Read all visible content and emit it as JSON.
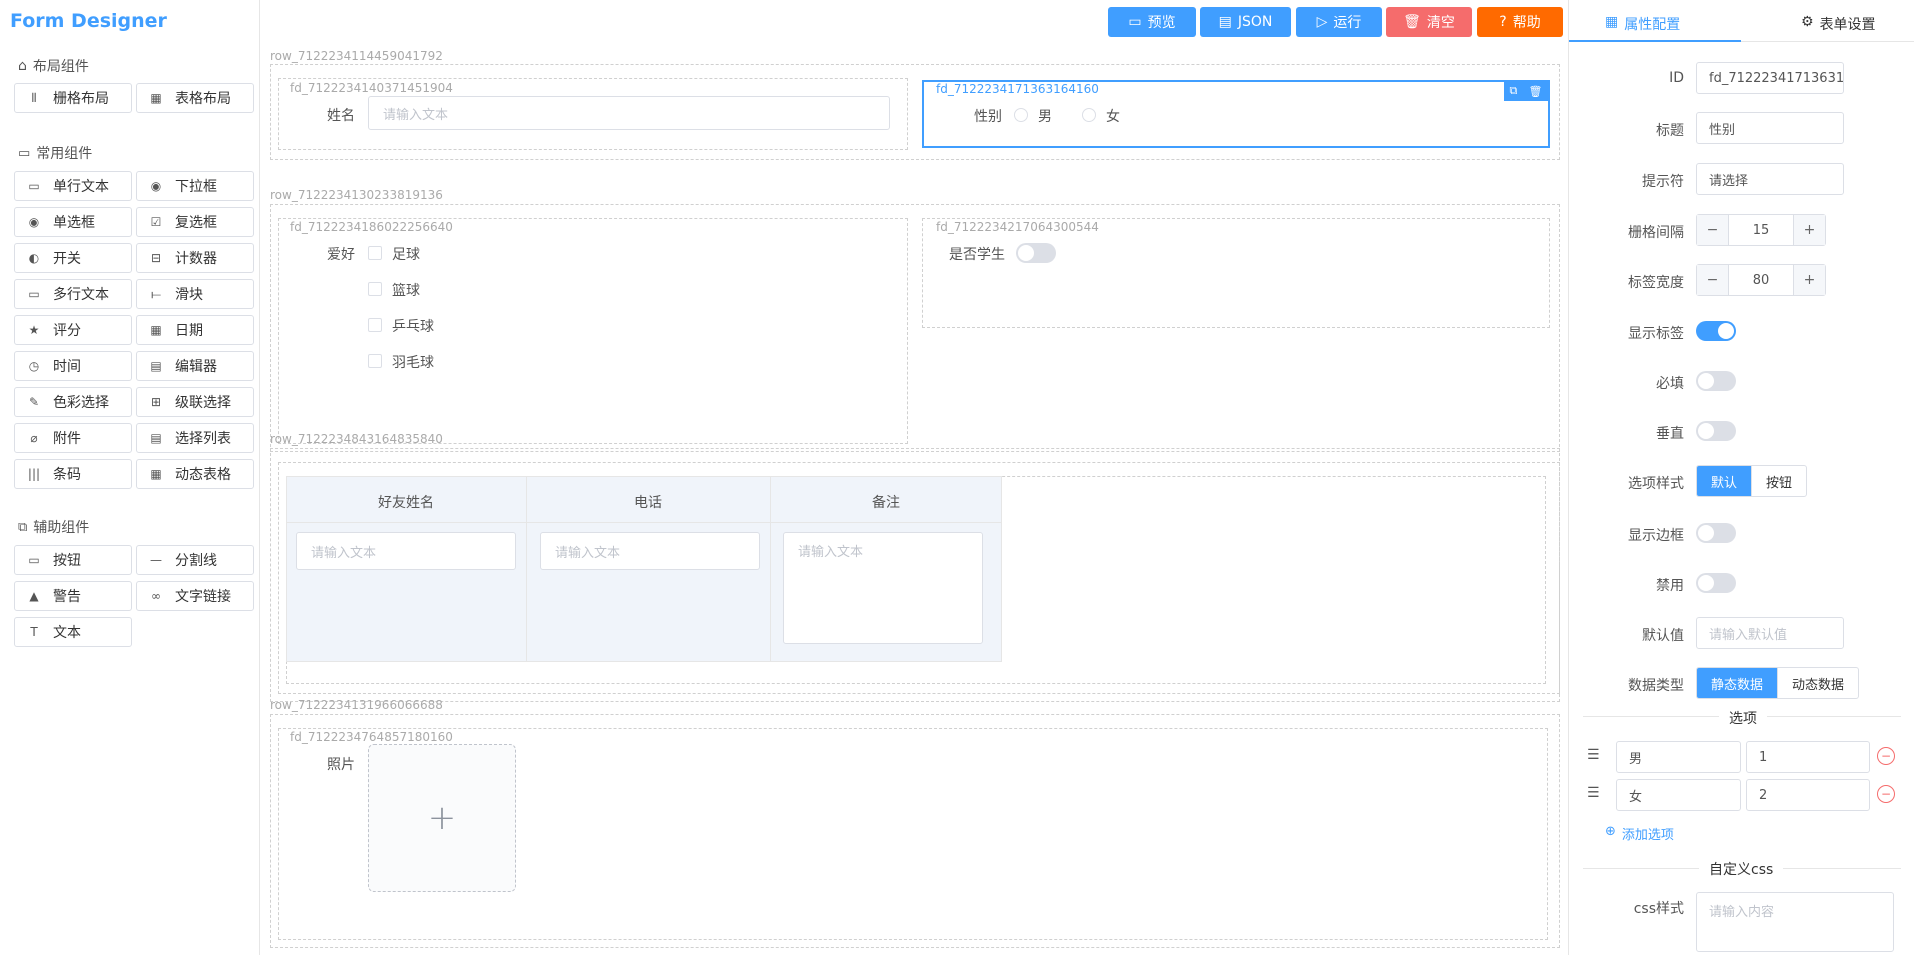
{
  "app": {
    "title": "Form Designer"
  },
  "groups": {
    "layout": {
      "title": "布局组件",
      "items": [
        "栅格布局",
        "表格布局"
      ]
    },
    "common": {
      "title": "常用组件",
      "items": [
        "单行文本",
        "下拉框",
        "单选框",
        "复选框",
        "开关",
        "计数器",
        "多行文本",
        "滑块",
        "评分",
        "日期",
        "时间",
        "编辑器",
        "色彩选择",
        "级联选择",
        "附件",
        "选择列表",
        "条码",
        "动态表格"
      ]
    },
    "aux": {
      "title": "辅助组件",
      "items": [
        "按钮",
        "分割线",
        "警告",
        "文字链接",
        "文本"
      ]
    }
  },
  "toolbar": {
    "preview": "预览",
    "json": "JSON",
    "run": "运行",
    "clear": "清空",
    "help": "帮助"
  },
  "colors": {
    "primary": "#409eff",
    "danger": "#f56c6c",
    "help": "#ff6a00",
    "border": "#dcdfe6"
  },
  "canvas": {
    "row1": {
      "id": "row_7122234114459041792",
      "name_field": {
        "id": "fd_7122234140371451904",
        "label": "姓名",
        "placeholder": "请输入文本"
      },
      "gender_field": {
        "id": "fd_7122234171363164160",
        "label": "性别",
        "options": [
          "男",
          "女"
        ]
      }
    },
    "row2": {
      "id": "row_7122234130233819136",
      "hobby_field": {
        "id": "fd_7122234186022256640",
        "label": "爱好",
        "options": [
          "足球",
          "篮球",
          "乒乓球",
          "羽毛球"
        ]
      },
      "student_field": {
        "id": "fd_7122234217064300544",
        "label": "是否学生"
      }
    },
    "row3": {
      "id": "row_7122234843164835840",
      "columns": [
        "好友姓名",
        "电话",
        "备注"
      ],
      "placeholder": "请输入文本"
    },
    "row4": {
      "id": "row_7122234131966066688",
      "photo_field": {
        "id": "fd_7122234764857180160",
        "label": "照片"
      }
    }
  },
  "right_panel": {
    "tabs": [
      "属性配置",
      "表单设置"
    ],
    "props": {
      "id": {
        "label": "ID",
        "value": "fd_71222341713631"
      },
      "title": {
        "label": "标题",
        "value": "性别"
      },
      "hint": {
        "label": "提示符",
        "value": "请选择"
      },
      "gutter": {
        "label": "栅格间隔",
        "value": "15"
      },
      "label_width": {
        "label": "标签宽度",
        "value": "80"
      },
      "show_label": {
        "label": "显示标签",
        "on": true
      },
      "required": {
        "label": "必填",
        "on": false
      },
      "vertical": {
        "label": "垂直",
        "on": false
      },
      "option_style": {
        "label": "选项样式",
        "options": [
          "默认",
          "按钮"
        ],
        "selected": "默认"
      },
      "show_border": {
        "label": "显示边框",
        "on": false
      },
      "disabled": {
        "label": "禁用",
        "on": false
      },
      "default_value": {
        "label": "默认值",
        "placeholder": "请输入默认值"
      },
      "data_type": {
        "label": "数据类型",
        "options": [
          "静态数据",
          "动态数据"
        ],
        "selected": "静态数据"
      }
    },
    "options_title": "选项",
    "options": [
      {
        "label": "男",
        "value": "1"
      },
      {
        "label": "女",
        "value": "2"
      }
    ],
    "add_option": "添加选项",
    "css_title": "自定义css",
    "css_label": "css样式",
    "css_placeholder": "请输入内容"
  }
}
